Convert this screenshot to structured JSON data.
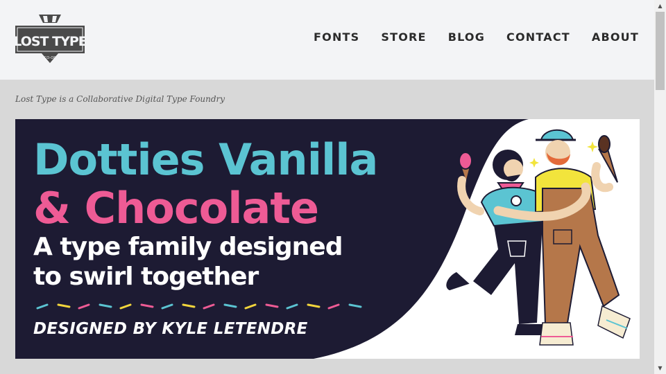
{
  "brand": {
    "logo_main": "LOST TYPE",
    "logo_sub": "CO-OP"
  },
  "nav": [
    "FONTS",
    "STORE",
    "BLOG",
    "CONTACT",
    "ABOUT"
  ],
  "tagline": "Lost Type is a Collaborative Digital Type Foundry",
  "banner": {
    "title_line1": "Dotties Vanilla",
    "title_line2": "& Chocolate",
    "subtitle_line1": "A type family designed",
    "subtitle_line2": "to swirl together",
    "credit": "DESIGNED BY KYLE LETENDRE"
  },
  "colors": {
    "header_bg": "#f3f4f6",
    "page_bg": "#d8d8d8",
    "banner_bg": "#1d1b33",
    "vanilla": "#5bc4d2",
    "chocolate": "#ee5b95"
  },
  "scrollbar": {
    "up_icon": "▲",
    "down_icon": "▼"
  }
}
